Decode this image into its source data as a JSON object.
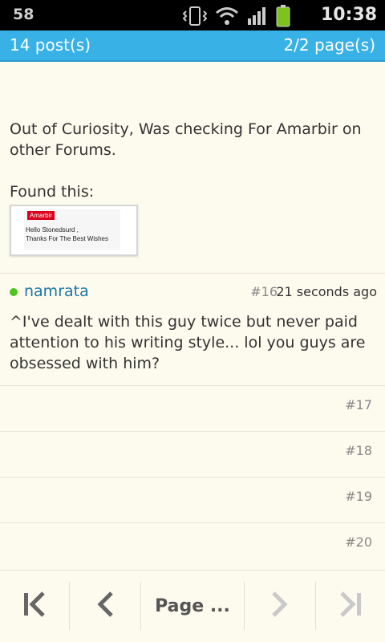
{
  "status_bar": {
    "notification_count": "58",
    "time": "10:38"
  },
  "header": {
    "posts": "14 post(s)",
    "pages": "2/2 page(s)"
  },
  "post_body": {
    "line1": "Out of Curiosity, Was checking For Amarbir on other Forums.",
    "line2": "Found this:",
    "thumb_tag": "Amarbir",
    "thumb_msg_line1": "Hello Stonedsurd ,",
    "thumb_msg_line2": "Thanks For The Best Wishes"
  },
  "post16": {
    "username": "namrata",
    "post_number": "#16",
    "time": "21 seconds ago",
    "text": "^I've dealt with this guy twice but never paid attention to his writing style... lol you guys are obsessed with him?"
  },
  "empty_posts": [
    "#17",
    "#18",
    "#19",
    "#20"
  ],
  "bottom_nav": {
    "page_label": "Page ..."
  },
  "colors": {
    "header_bg": "#38b1e6",
    "background": "#fdfaee",
    "username": "#1a78a8",
    "online": "#4fc420"
  }
}
